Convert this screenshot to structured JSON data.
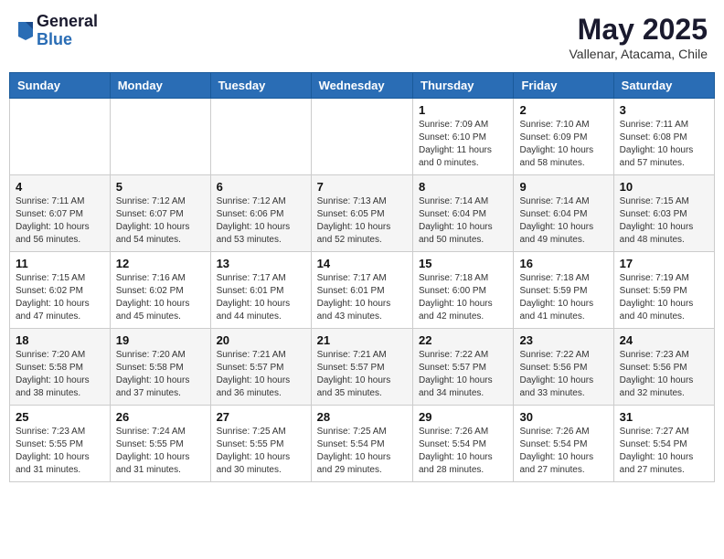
{
  "header": {
    "logo_general": "General",
    "logo_blue": "Blue",
    "month": "May 2025",
    "location": "Vallenar, Atacama, Chile"
  },
  "weekdays": [
    "Sunday",
    "Monday",
    "Tuesday",
    "Wednesday",
    "Thursday",
    "Friday",
    "Saturday"
  ],
  "weeks": [
    [
      {
        "day": "",
        "info": ""
      },
      {
        "day": "",
        "info": ""
      },
      {
        "day": "",
        "info": ""
      },
      {
        "day": "",
        "info": ""
      },
      {
        "day": "1",
        "info": "Sunrise: 7:09 AM\nSunset: 6:10 PM\nDaylight: 11 hours\nand 0 minutes."
      },
      {
        "day": "2",
        "info": "Sunrise: 7:10 AM\nSunset: 6:09 PM\nDaylight: 10 hours\nand 58 minutes."
      },
      {
        "day": "3",
        "info": "Sunrise: 7:11 AM\nSunset: 6:08 PM\nDaylight: 10 hours\nand 57 minutes."
      }
    ],
    [
      {
        "day": "4",
        "info": "Sunrise: 7:11 AM\nSunset: 6:07 PM\nDaylight: 10 hours\nand 56 minutes."
      },
      {
        "day": "5",
        "info": "Sunrise: 7:12 AM\nSunset: 6:07 PM\nDaylight: 10 hours\nand 54 minutes."
      },
      {
        "day": "6",
        "info": "Sunrise: 7:12 AM\nSunset: 6:06 PM\nDaylight: 10 hours\nand 53 minutes."
      },
      {
        "day": "7",
        "info": "Sunrise: 7:13 AM\nSunset: 6:05 PM\nDaylight: 10 hours\nand 52 minutes."
      },
      {
        "day": "8",
        "info": "Sunrise: 7:14 AM\nSunset: 6:04 PM\nDaylight: 10 hours\nand 50 minutes."
      },
      {
        "day": "9",
        "info": "Sunrise: 7:14 AM\nSunset: 6:04 PM\nDaylight: 10 hours\nand 49 minutes."
      },
      {
        "day": "10",
        "info": "Sunrise: 7:15 AM\nSunset: 6:03 PM\nDaylight: 10 hours\nand 48 minutes."
      }
    ],
    [
      {
        "day": "11",
        "info": "Sunrise: 7:15 AM\nSunset: 6:02 PM\nDaylight: 10 hours\nand 47 minutes."
      },
      {
        "day": "12",
        "info": "Sunrise: 7:16 AM\nSunset: 6:02 PM\nDaylight: 10 hours\nand 45 minutes."
      },
      {
        "day": "13",
        "info": "Sunrise: 7:17 AM\nSunset: 6:01 PM\nDaylight: 10 hours\nand 44 minutes."
      },
      {
        "day": "14",
        "info": "Sunrise: 7:17 AM\nSunset: 6:01 PM\nDaylight: 10 hours\nand 43 minutes."
      },
      {
        "day": "15",
        "info": "Sunrise: 7:18 AM\nSunset: 6:00 PM\nDaylight: 10 hours\nand 42 minutes."
      },
      {
        "day": "16",
        "info": "Sunrise: 7:18 AM\nSunset: 5:59 PM\nDaylight: 10 hours\nand 41 minutes."
      },
      {
        "day": "17",
        "info": "Sunrise: 7:19 AM\nSunset: 5:59 PM\nDaylight: 10 hours\nand 40 minutes."
      }
    ],
    [
      {
        "day": "18",
        "info": "Sunrise: 7:20 AM\nSunset: 5:58 PM\nDaylight: 10 hours\nand 38 minutes."
      },
      {
        "day": "19",
        "info": "Sunrise: 7:20 AM\nSunset: 5:58 PM\nDaylight: 10 hours\nand 37 minutes."
      },
      {
        "day": "20",
        "info": "Sunrise: 7:21 AM\nSunset: 5:57 PM\nDaylight: 10 hours\nand 36 minutes."
      },
      {
        "day": "21",
        "info": "Sunrise: 7:21 AM\nSunset: 5:57 PM\nDaylight: 10 hours\nand 35 minutes."
      },
      {
        "day": "22",
        "info": "Sunrise: 7:22 AM\nSunset: 5:57 PM\nDaylight: 10 hours\nand 34 minutes."
      },
      {
        "day": "23",
        "info": "Sunrise: 7:22 AM\nSunset: 5:56 PM\nDaylight: 10 hours\nand 33 minutes."
      },
      {
        "day": "24",
        "info": "Sunrise: 7:23 AM\nSunset: 5:56 PM\nDaylight: 10 hours\nand 32 minutes."
      }
    ],
    [
      {
        "day": "25",
        "info": "Sunrise: 7:23 AM\nSunset: 5:55 PM\nDaylight: 10 hours\nand 31 minutes."
      },
      {
        "day": "26",
        "info": "Sunrise: 7:24 AM\nSunset: 5:55 PM\nDaylight: 10 hours\nand 31 minutes."
      },
      {
        "day": "27",
        "info": "Sunrise: 7:25 AM\nSunset: 5:55 PM\nDaylight: 10 hours\nand 30 minutes."
      },
      {
        "day": "28",
        "info": "Sunrise: 7:25 AM\nSunset: 5:54 PM\nDaylight: 10 hours\nand 29 minutes."
      },
      {
        "day": "29",
        "info": "Sunrise: 7:26 AM\nSunset: 5:54 PM\nDaylight: 10 hours\nand 28 minutes."
      },
      {
        "day": "30",
        "info": "Sunrise: 7:26 AM\nSunset: 5:54 PM\nDaylight: 10 hours\nand 27 minutes."
      },
      {
        "day": "31",
        "info": "Sunrise: 7:27 AM\nSunset: 5:54 PM\nDaylight: 10 hours\nand 27 minutes."
      }
    ]
  ]
}
